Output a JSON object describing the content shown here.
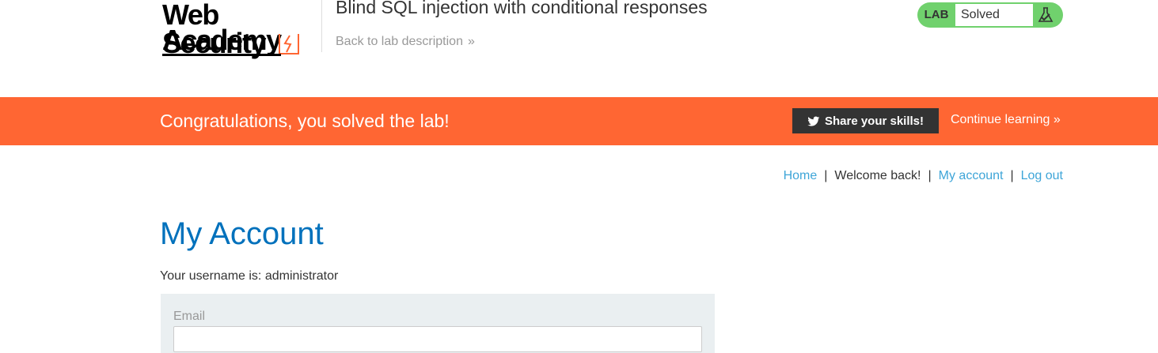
{
  "header": {
    "logo_line1": "Web Security",
    "logo_line2": "Academy",
    "lab_title": "Blind SQL injection with conditional responses",
    "back_link": "Back to lab description",
    "status": {
      "lab_label": "LAB",
      "status_text": "Solved"
    },
    "colors": {
      "status_green": "#70d16d",
      "logo_accent": "#ff6633"
    }
  },
  "banner": {
    "message": "Congratulations, you solved the lab!",
    "share_button": "Share your skills!",
    "continue_link": "Continue learning",
    "color": "#ff6633"
  },
  "nav": {
    "home": "Home",
    "welcome": "Welcome back!",
    "my_account": "My account",
    "log_out": "Log out",
    "separator": "|"
  },
  "main": {
    "title": "My Account",
    "username_line": "Your username is: administrator",
    "email_label": "Email",
    "email_value": ""
  },
  "icons": {
    "back": "double-chevron-right-icon",
    "continue": "double-chevron-right-icon",
    "share": "twitter-icon",
    "status": "flask-icon"
  }
}
